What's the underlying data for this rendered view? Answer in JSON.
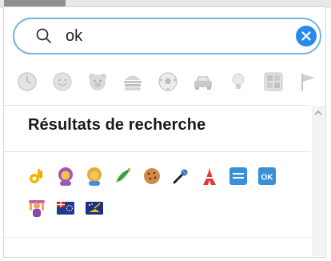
{
  "search": {
    "value": "ok",
    "placeholder": ""
  },
  "icons": {
    "search": "search-icon",
    "clear": "close-icon",
    "scroll_up": "chevron-up-icon"
  },
  "categories": [
    {
      "name": "recent",
      "icon": "clock-icon"
    },
    {
      "name": "smileys",
      "icon": "smiley-icon"
    },
    {
      "name": "animals",
      "icon": "bear-icon"
    },
    {
      "name": "food",
      "icon": "burger-icon"
    },
    {
      "name": "activities",
      "icon": "soccer-ball-icon"
    },
    {
      "name": "travel",
      "icon": "car-icon"
    },
    {
      "name": "objects",
      "icon": "lightbulb-icon"
    },
    {
      "name": "symbols",
      "icon": "symbols-icon"
    },
    {
      "name": "flags",
      "icon": "flag-icon"
    }
  ],
  "results_section": {
    "title": "Résultats de recherche"
  },
  "results": [
    {
      "icon": "ok-hand-icon"
    },
    {
      "icon": "woman-ok-gesture-icon"
    },
    {
      "icon": "person-ok-gesture-icon"
    },
    {
      "icon": "okra-icon"
    },
    {
      "icon": "cookie-icon"
    },
    {
      "icon": "microphone-icon"
    },
    {
      "icon": "tokyo-tower-icon"
    },
    {
      "icon": "id-button-icon"
    },
    {
      "icon": "ok-button-icon",
      "text": "OK"
    },
    {
      "icon": "man-ok-gesture-icon"
    },
    {
      "icon": "flag-cook-islands-icon"
    },
    {
      "icon": "flag-tokelau-icon"
    }
  ],
  "colors": {
    "accent": "#2b8ae8",
    "search_border": "#77b3df",
    "category_gray": "#c9c9c9"
  }
}
